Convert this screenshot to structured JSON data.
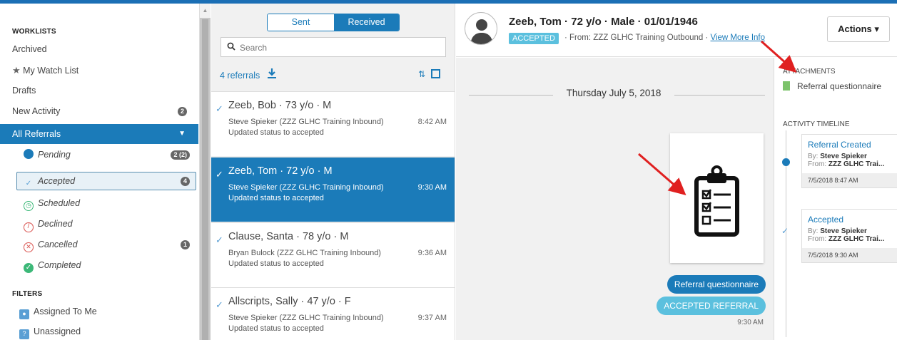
{
  "sidebar": {
    "worklists_heading": "WORKLISTS",
    "items": {
      "archived": "Archived",
      "watch_list": "My Watch List",
      "drafts": "Drafts",
      "new_activity": "New Activity",
      "new_activity_count": "2"
    },
    "all_referrals": "All Referrals",
    "statuses": {
      "pending": "Pending",
      "pending_count": "2 (2)",
      "accepted": "Accepted",
      "accepted_count": "4",
      "scheduled": "Scheduled",
      "declined": "Declined",
      "cancelled": "Cancelled",
      "cancelled_count": "1",
      "completed": "Completed"
    },
    "filters_heading": "FILTERS",
    "filters": {
      "assigned": "Assigned To Me",
      "unassigned": "Unassigned"
    }
  },
  "list": {
    "tab_sent": "Sent",
    "tab_received": "Received",
    "search_placeholder": "Search",
    "count_label": "4 referrals",
    "rows": [
      {
        "name": "Zeeb, Bob · 73 y/o · M",
        "org": "Steve Spieker (ZZZ GLHC Training Inbound)",
        "status": "Updated status to accepted",
        "time": "8:42 AM"
      },
      {
        "name": "Zeeb, Tom · 72 y/o · M",
        "org": "Steve Spieker (ZZZ GLHC Training Inbound)",
        "status": "Updated status to accepted",
        "time": "9:30 AM"
      },
      {
        "name": "Clause, Santa · 78 y/o · M",
        "org": "Bryan Bulock (ZZZ GLHC Training Inbound)",
        "status": "Updated status to accepted",
        "time": "9:36 AM"
      },
      {
        "name": "Allscripts, Sally · 47 y/o · F",
        "org": "Steve Spieker (ZZZ GLHC Training Inbound)",
        "status": "Updated status to accepted",
        "time": "9:37 AM"
      }
    ]
  },
  "detail": {
    "patient_title": "Zeeb, Tom · 72 y/o · Male · 01/01/1946",
    "status_badge": "ACCEPTED",
    "from_text": "· From: ZZZ GLHC Training Outbound ·",
    "view_more": "View More Info",
    "actions_label": "Actions ▾",
    "date_heading": "Thursday July 5, 2018",
    "bubble_questionnaire": "Referral questionnaire",
    "bubble_accepted": "ACCEPTED REFERRAL",
    "bubble_time": "9:30 AM"
  },
  "right_panel": {
    "attachments_heading": "ATTACHMENTS",
    "attachment_name": "Referral questionnaire",
    "timeline_heading": "ACTIVITY TIMELINE",
    "events": [
      {
        "title": "Referral Created",
        "by_label": "By:",
        "by": "Steve Spieker",
        "from_label": "From:",
        "from": "ZZZ GLHC Trai...",
        "time": "7/5/2018 8:47 AM"
      },
      {
        "title": "Accepted",
        "by_label": "By:",
        "by": "Steve Spieker",
        "from_label": "From:",
        "from": "ZZZ GLHC Trai...",
        "time": "7/5/2018 9:30 AM"
      }
    ]
  },
  "colors": {
    "primary": "#1b7bb9",
    "accent_light": "#5bc0de",
    "annotation": "#e02020"
  },
  "icons": [
    "star-icon",
    "search-icon",
    "download-icon",
    "sort-icon",
    "checkmark-icon",
    "clipboard-checklist-icon",
    "avatar-icon",
    "file-icon"
  ]
}
